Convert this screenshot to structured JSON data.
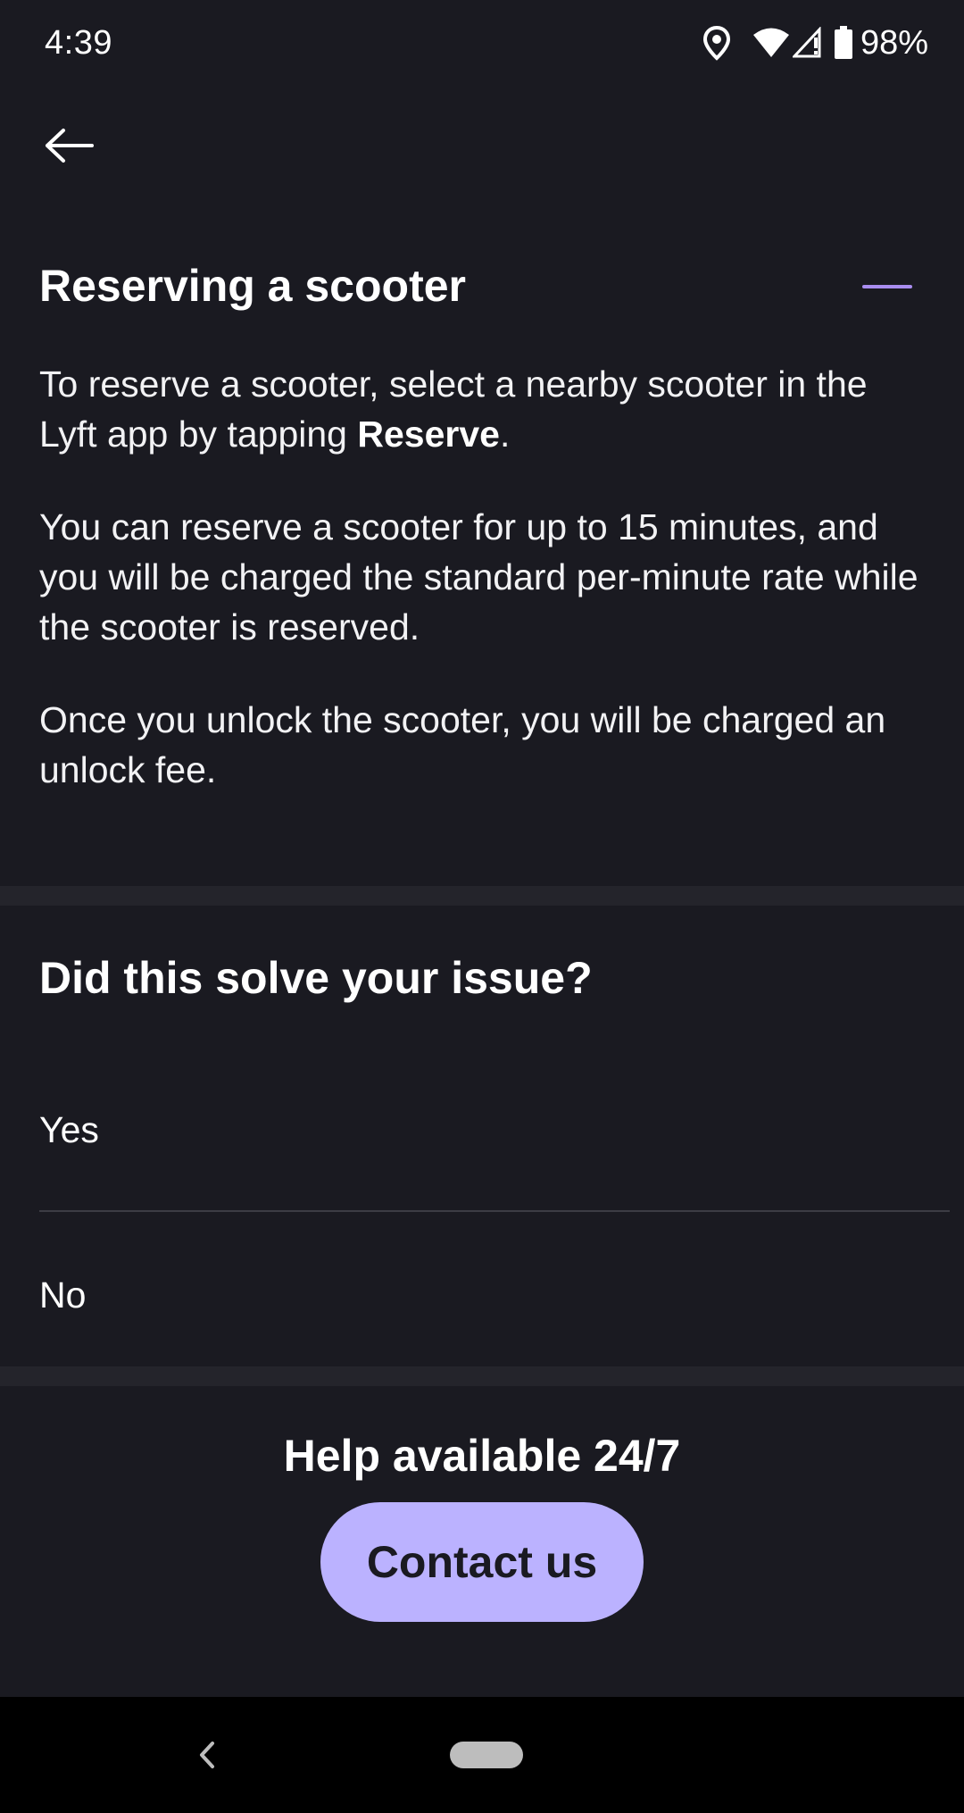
{
  "status_bar": {
    "time": "4:39",
    "battery": "98%",
    "icons": [
      "location-icon",
      "wifi-icon",
      "signal-icon",
      "battery-icon"
    ]
  },
  "header": {
    "back_icon": "arrow-left-icon"
  },
  "article": {
    "title": "Reserving a scooter",
    "toggle_icon": "minus-icon",
    "p1_before": "To reserve a scooter, select a nearby scooter in the Lyft app by tapping ",
    "p1_bold": "Reserve",
    "p1_after": ".",
    "p2": "You can reserve a scooter for up to 15 minutes, and you will be charged the standard per-minute rate while the scooter is reserved.",
    "p3": "Once you unlock the scooter, you will be charged an unlock fee."
  },
  "feedback": {
    "question": "Did this solve your issue?",
    "options": [
      {
        "label": "Yes"
      },
      {
        "label": "No"
      }
    ]
  },
  "help": {
    "title": "Help available 24/7",
    "contact_label": "Contact us"
  },
  "colors": {
    "background": "#1a1a21",
    "accent": "#bbb2ff",
    "toggle": "#a98df0"
  }
}
